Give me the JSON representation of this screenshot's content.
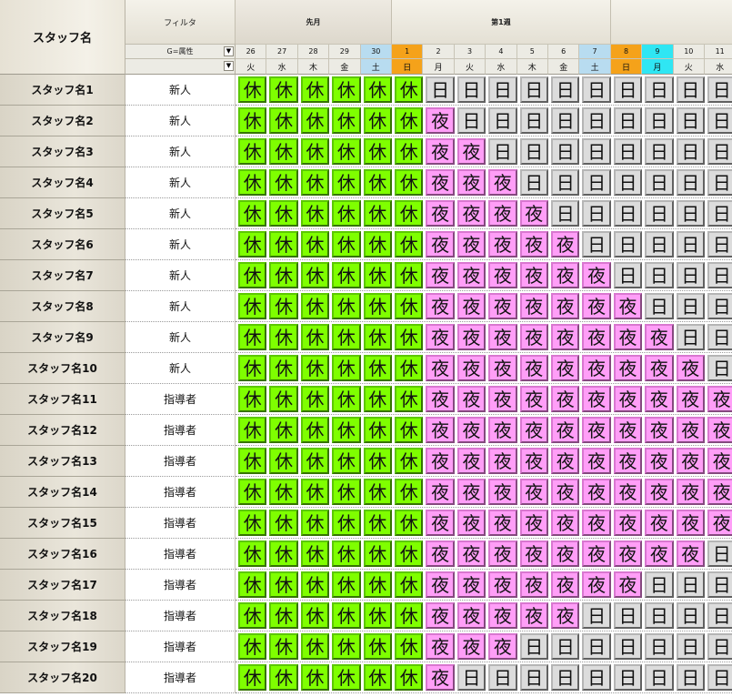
{
  "header": {
    "staff_title": "スタッフ名",
    "filter_label": "フィルタ",
    "attr_dropdown": "G=属性",
    "attr_dropdown2": "",
    "dropdown_arrow": "▼"
  },
  "week_groups": [
    {
      "label": "先月",
      "kind": "prevmonth",
      "span": 5
    },
    {
      "label": "第1週",
      "kind": "week",
      "span": 7
    },
    {
      "label": "第2週",
      "kind": "week",
      "span": 5
    }
  ],
  "dates": [
    {
      "d": "26",
      "w": "火",
      "style": "prev"
    },
    {
      "d": "27",
      "w": "水",
      "style": "prev"
    },
    {
      "d": "28",
      "w": "木",
      "style": "prev"
    },
    {
      "d": "29",
      "w": "金",
      "style": "prev"
    },
    {
      "d": "30",
      "w": "土",
      "style": "sat"
    },
    {
      "d": "1",
      "w": "日",
      "style": "sun"
    },
    {
      "d": "2",
      "w": "月",
      "style": ""
    },
    {
      "d": "3",
      "w": "火",
      "style": ""
    },
    {
      "d": "4",
      "w": "水",
      "style": ""
    },
    {
      "d": "5",
      "w": "木",
      "style": ""
    },
    {
      "d": "6",
      "w": "金",
      "style": ""
    },
    {
      "d": "7",
      "w": "土",
      "style": "sat"
    },
    {
      "d": "8",
      "w": "日",
      "style": "sun"
    },
    {
      "d": "9",
      "w": "月",
      "style": "holiday"
    },
    {
      "d": "10",
      "w": "火",
      "style": ""
    },
    {
      "d": "11",
      "w": "水",
      "style": ""
    }
  ],
  "header_colors": {
    "sat": "#b8dcf0",
    "sun": "#f5a21a",
    "holiday": "#2fe6f3",
    "prev": "#ecebe4",
    "plain": "#ecebe4"
  },
  "shift_labels": {
    "rest": "休",
    "night": "夜",
    "day": "日"
  },
  "shift_colors": {
    "rest": "#7fff00",
    "night": "#ff9ef7",
    "day": "#dcdcdc"
  },
  "rows": [
    {
      "name": "スタッフ名1",
      "attr": "新人",
      "night_count": 0
    },
    {
      "name": "スタッフ名2",
      "attr": "新人",
      "night_count": 1
    },
    {
      "name": "スタッフ名3",
      "attr": "新人",
      "night_count": 2
    },
    {
      "name": "スタッフ名4",
      "attr": "新人",
      "night_count": 3
    },
    {
      "name": "スタッフ名5",
      "attr": "新人",
      "night_count": 4
    },
    {
      "name": "スタッフ名6",
      "attr": "新人",
      "night_count": 5
    },
    {
      "name": "スタッフ名7",
      "attr": "新人",
      "night_count": 6
    },
    {
      "name": "スタッフ名8",
      "attr": "新人",
      "night_count": 7
    },
    {
      "name": "スタッフ名9",
      "attr": "新人",
      "night_count": 8
    },
    {
      "name": "スタッフ名10",
      "attr": "新人",
      "night_count": 9
    },
    {
      "name": "スタッフ名11",
      "attr": "指導者",
      "night_count": 10
    },
    {
      "name": "スタッフ名12",
      "attr": "指導者",
      "night_count": 10
    },
    {
      "name": "スタッフ名13",
      "attr": "指導者",
      "night_count": 10
    },
    {
      "name": "スタッフ名14",
      "attr": "指導者",
      "night_count": 10
    },
    {
      "name": "スタッフ名15",
      "attr": "指導者",
      "night_count": 10
    },
    {
      "name": "スタッフ名16",
      "attr": "指導者",
      "night_count": 9
    },
    {
      "name": "スタッフ名17",
      "attr": "指導者",
      "night_count": 7
    },
    {
      "name": "スタッフ名18",
      "attr": "指導者",
      "night_count": 5
    },
    {
      "name": "スタッフ名19",
      "attr": "指導者",
      "night_count": 3
    },
    {
      "name": "スタッフ名20",
      "attr": "指導者",
      "night_count": 1
    }
  ]
}
